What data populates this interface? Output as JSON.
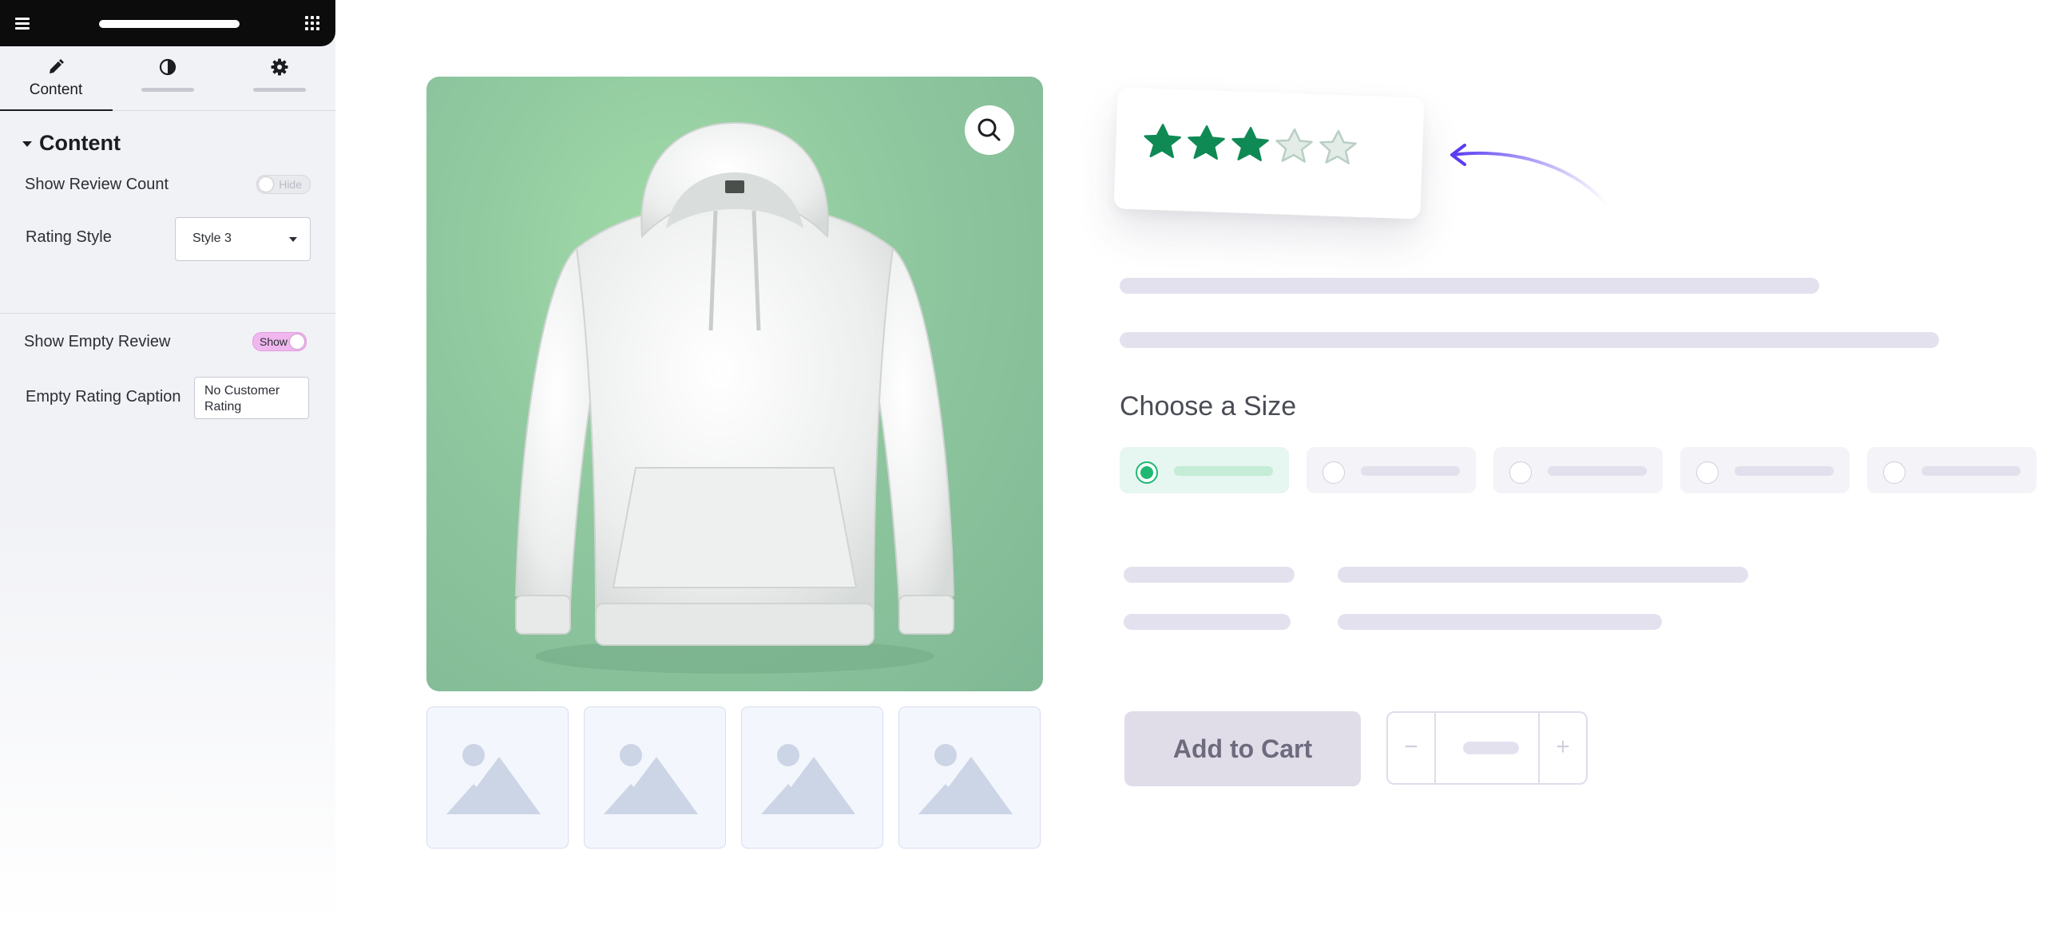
{
  "editor": {
    "tabs": [
      {
        "label": "Content",
        "icon": "pencil-icon",
        "active": true
      },
      {
        "label": "",
        "icon": "contrast-icon",
        "active": false
      },
      {
        "label": "",
        "icon": "gear-icon",
        "active": false
      }
    ],
    "section_title": "Content",
    "show_review_count": {
      "label": "Show Review Count",
      "toggle_text": "Hide",
      "state": "off"
    },
    "rating_style": {
      "label": "Rating Style",
      "value": "Style 3"
    },
    "show_empty_review": {
      "label": "Show Empty Review",
      "toggle_text": "Show",
      "state": "on"
    },
    "empty_rating_caption": {
      "label": "Empty Rating Caption",
      "value": "No Customer Rating"
    }
  },
  "product": {
    "rating": {
      "value": 3,
      "max": 5,
      "style": "Style 3"
    },
    "size_section_title": "Choose a Size",
    "size_selected_index": 0,
    "add_to_cart_label": "Add to Cart",
    "quantity": {
      "minus": "−",
      "plus": "+"
    }
  },
  "colors": {
    "accent_green": "#1fb873",
    "star_green": "#0f8a55",
    "arrow_purple": "#5b3bf0",
    "toggle_on_pink": "#f0b7ee",
    "image_bg_green": "#8fc79f"
  }
}
